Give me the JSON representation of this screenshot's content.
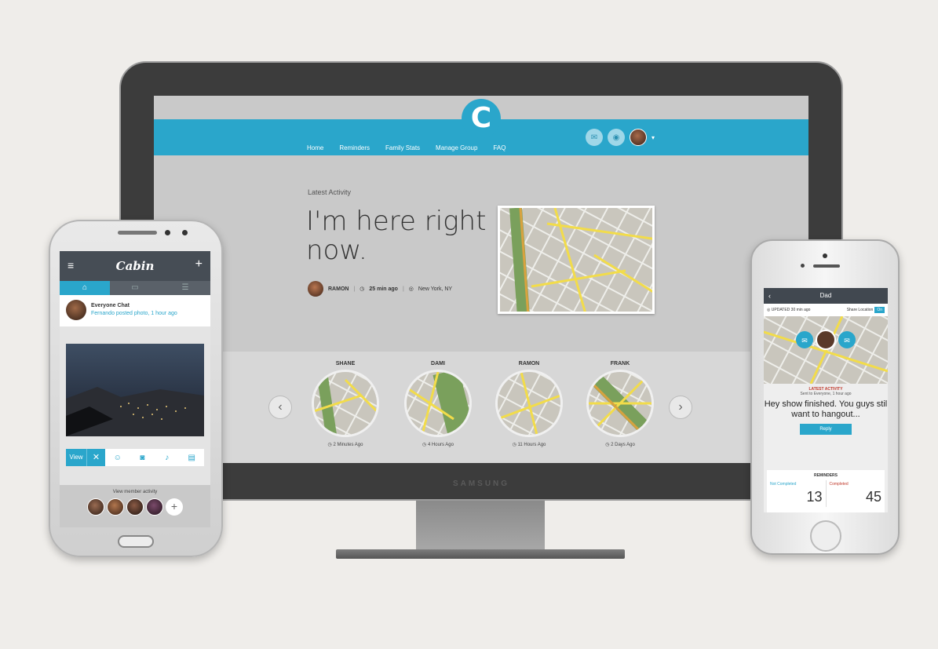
{
  "monitor": {
    "brand": "SAMSUNG",
    "logo_letter": "C",
    "nav": [
      "Home",
      "Reminders",
      "Family Stats",
      "Manage Group",
      "FAQ"
    ],
    "latest_label": "Latest Activity",
    "headline": "I'm here right now.",
    "author": "RAMON",
    "time_ago": "25 min ago",
    "location": "New York, NY",
    "members": [
      {
        "name": "SHANE",
        "time": "2 Minutes Ago"
      },
      {
        "name": "DAMI",
        "time": "4 Hours Ago"
      },
      {
        "name": "RAMON",
        "time": "11 Hours Ago"
      },
      {
        "name": "FRANK",
        "time": "2 Days Ago"
      }
    ]
  },
  "android": {
    "app_title": "Cabin",
    "chat_title": "Everyone Chat",
    "chat_sub": "Fernando posted photo, 1 hour ago",
    "view_label": "View",
    "members_label": "View member activity"
  },
  "iphone": {
    "title": "Dad",
    "updated": "UPDATED 30 min ago",
    "share": "Share Location",
    "share_toggle": "On",
    "latest_activity": "LATEST ACTIVITY",
    "sent": "Sent to Everyone, 1 hour ago",
    "message": "Hey show finished. You guys stil want to hangout...",
    "reply": "Reply",
    "reminders": "REMINDERS",
    "not_completed_label": "Not Completed",
    "not_completed": "13",
    "completed_label": "Completed",
    "completed": "45"
  },
  "colors": {
    "accent": "#2aa6cb",
    "bar": "#464d55",
    "alert": "#c0392b"
  }
}
